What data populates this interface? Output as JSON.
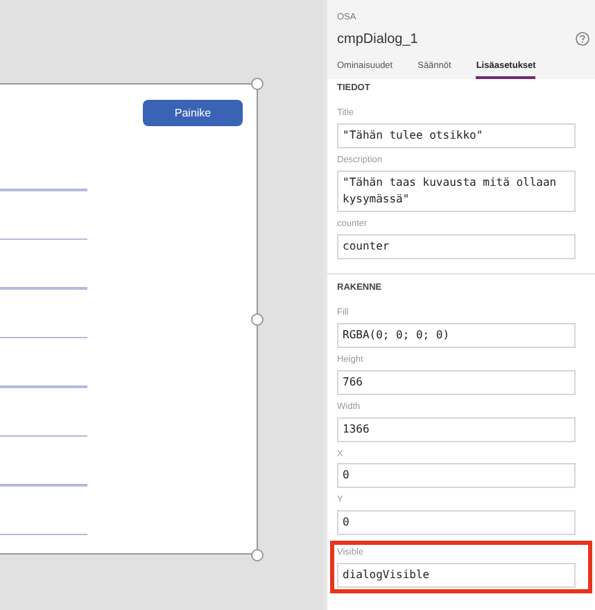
{
  "canvas": {
    "button": {
      "label": "Painike"
    }
  },
  "panel": {
    "caption": "OSA",
    "title": "cmpDialog_1",
    "tabs": [
      {
        "label": "Ominaisuudet",
        "selected": false
      },
      {
        "label": "Säännöt",
        "selected": false
      },
      {
        "label": "Lisäasetukset",
        "selected": true
      }
    ],
    "sections": [
      {
        "heading": "TIEDOT",
        "properties": [
          {
            "label": "Title",
            "value": "\"Tähän tulee otsikko\"",
            "highlighted": false
          },
          {
            "label": "Description",
            "value": "\"Tähän taas kuvausta mitä ollaan kysymässä\"",
            "highlighted": false
          },
          {
            "label": "counter",
            "value": "counter",
            "highlighted": false
          }
        ]
      },
      {
        "heading": "RAKENNE",
        "properties": [
          {
            "label": "Fill",
            "value": "RGBA(0; 0; 0; 0)",
            "highlighted": false
          },
          {
            "label": "Height",
            "value": "766",
            "highlighted": false
          },
          {
            "label": "Width",
            "value": "1366",
            "highlighted": false
          },
          {
            "label": "X",
            "value": "0",
            "highlighted": false
          },
          {
            "label": "Y",
            "value": "0",
            "highlighted": false
          },
          {
            "label": "Visible",
            "value": "dialogVisible",
            "highlighted": true
          }
        ]
      }
    ]
  }
}
